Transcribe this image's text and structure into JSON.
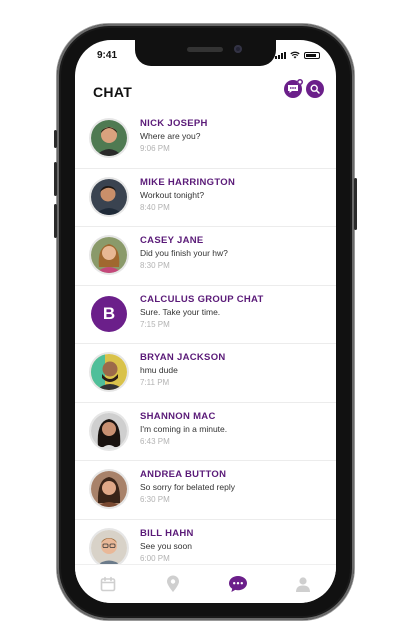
{
  "status_bar": {
    "time": "9:41"
  },
  "header": {
    "title": "CHAT"
  },
  "chats": [
    {
      "name": "NICK JOSEPH",
      "message": "Where are you?",
      "time": "9:06 PM"
    },
    {
      "name": "MIKE HARRINGTON",
      "message": "Workout tonight?",
      "time": "8:40 PM"
    },
    {
      "name": "CASEY JANE",
      "message": "Did you finish your hw?",
      "time": "8:30 PM"
    },
    {
      "name": "CALCULUS GROUP CHAT",
      "message": "Sure. Take your time.",
      "time": "7:15 PM"
    },
    {
      "name": "BRYAN JACKSON",
      "message": "hmu dude",
      "time": "7:11 PM"
    },
    {
      "name": "SHANNON MAC",
      "message": "I'm coming in a minute.",
      "time": "6:43 PM"
    },
    {
      "name": "ANDREA BUTTON",
      "message": "So sorry for belated reply",
      "time": "6:30 PM"
    },
    {
      "name": "BILL HAHN",
      "message": "See you soon",
      "time": "6:00 PM"
    }
  ],
  "group_avatar_letter": "B",
  "tabs": [
    {
      "icon": "calendar-icon",
      "active": false
    },
    {
      "icon": "location-pin-icon",
      "active": false
    },
    {
      "icon": "chat-bubble-icon",
      "active": true
    },
    {
      "icon": "profile-icon",
      "active": false
    }
  ],
  "colors": {
    "accent": "#6b1f8a",
    "name": "#5a1a78",
    "inactive_tab": "#cfcfcf"
  }
}
